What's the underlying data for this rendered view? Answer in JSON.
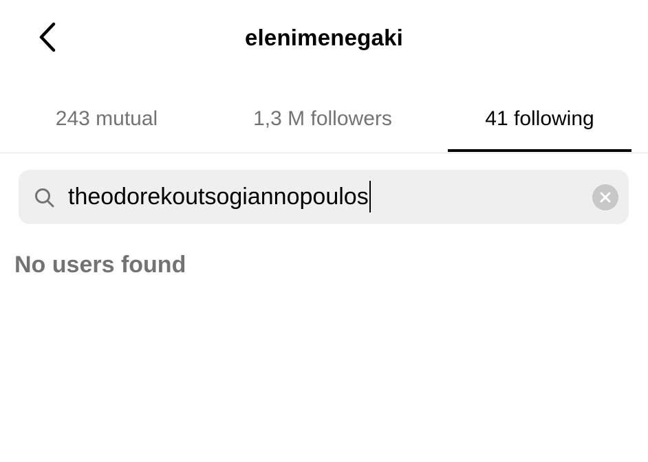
{
  "header": {
    "title": "elenimenegaki",
    "back_icon": "chevron-left-icon"
  },
  "tabs": [
    {
      "label": "243 mutual",
      "active": false
    },
    {
      "label": "1,3 M followers",
      "active": false
    },
    {
      "label": "41 following",
      "active": true
    }
  ],
  "search": {
    "icon": "search-icon",
    "value": "theodorekoutsogiannopoulos",
    "clear_icon": "clear-circle-icon"
  },
  "results": {
    "empty_message": "No users found"
  },
  "colors": {
    "text_primary": "#000000",
    "text_secondary": "#737373",
    "search_bg": "#efefef",
    "clear_bg": "#c7c7c7",
    "divider": "#e6e6e6"
  }
}
